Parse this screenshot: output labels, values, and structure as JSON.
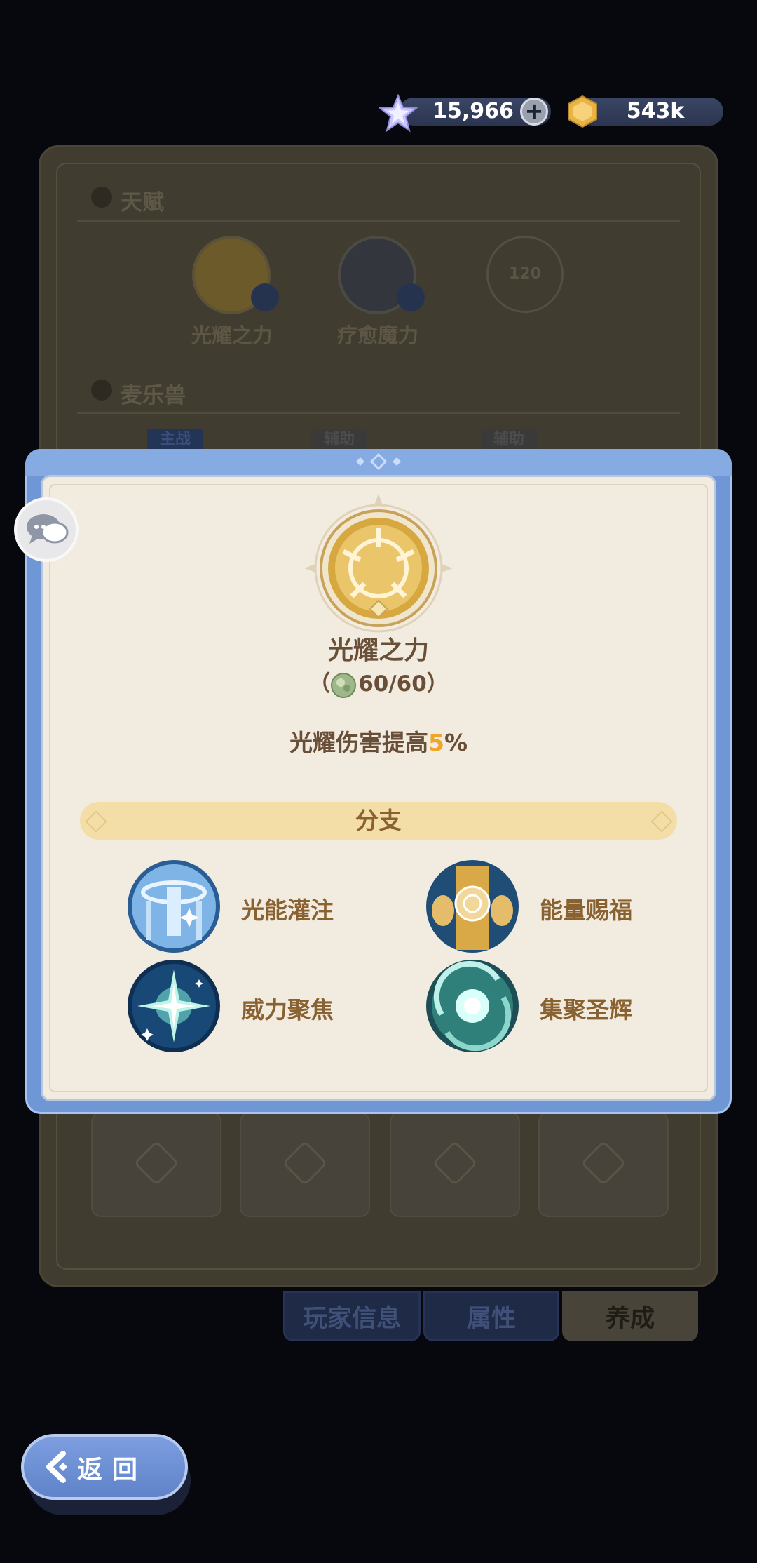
{
  "currency": {
    "gems": "15,966",
    "gold": "543k"
  },
  "background": {
    "talent_section_title": "天赋",
    "talents": [
      "光耀之力",
      "疗愈魔力"
    ],
    "locked_talent_level": "120",
    "pet_section_title": "麦乐兽",
    "pet_tags": [
      "主战",
      "辅助",
      "辅助"
    ],
    "tabs": [
      "玩家信息",
      "属性",
      "养成"
    ]
  },
  "popup": {
    "title": "光耀之力",
    "cost_open": "（",
    "cost_value": "60/60",
    "cost_close": "）",
    "desc_prefix": "光耀伤害提高",
    "desc_value": "5",
    "desc_suffix": "%",
    "branch_title": "分支",
    "branches": [
      "光能灌注",
      "能量赐福",
      "威力聚焦",
      "集聚圣辉"
    ]
  },
  "back_button": {
    "label": "返回"
  }
}
